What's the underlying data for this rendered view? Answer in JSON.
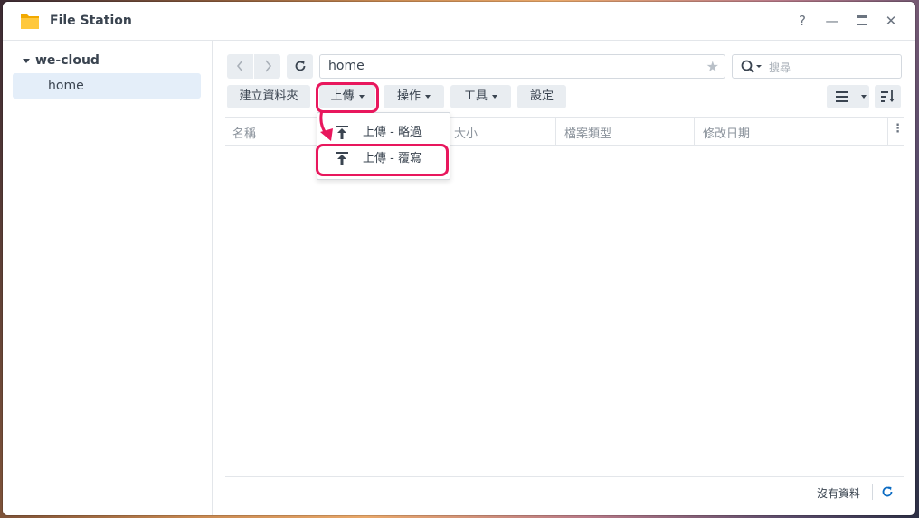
{
  "window": {
    "title": "File Station",
    "help_glyph": "?",
    "minimize_glyph": "—",
    "maximize_glyph": "▭",
    "close_glyph": "✕"
  },
  "sidebar": {
    "root_label": "we-cloud",
    "items": [
      {
        "label": "home",
        "selected": true
      }
    ]
  },
  "toolbar": {
    "path": "home",
    "search_placeholder": "搜尋",
    "create_folder_label": "建立資料夾",
    "upload_label": "上傳",
    "action_label": "操作",
    "tools_label": "工具",
    "settings_label": "設定"
  },
  "upload_menu": {
    "items": [
      {
        "label": "上傳 - 略過",
        "icon": "upload-icon"
      },
      {
        "label": "上傳 - 覆寫",
        "icon": "upload-icon"
      }
    ]
  },
  "table": {
    "columns": [
      "名稱",
      "大小",
      "檔案類型",
      "修改日期"
    ]
  },
  "footer": {
    "status": "沒有資料"
  },
  "colors": {
    "highlight": "#e8175d",
    "accent": "#0b6bc2",
    "selected_bg": "#e4eef9"
  }
}
